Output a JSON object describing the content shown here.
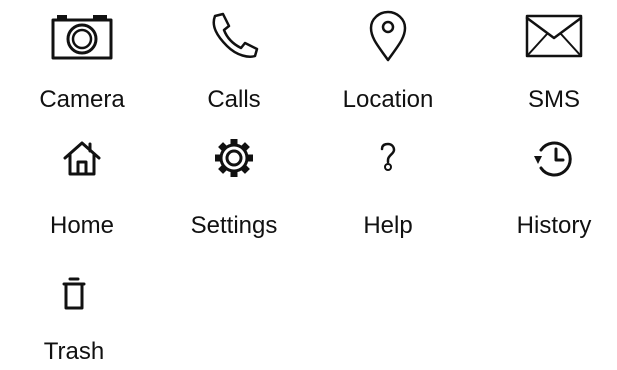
{
  "apps": [
    {
      "label": "Camera",
      "icon": "camera-icon"
    },
    {
      "label": "Calls",
      "icon": "phone-icon"
    },
    {
      "label": "Location",
      "icon": "map-pin-icon"
    },
    {
      "label": "SMS",
      "icon": "envelope-icon"
    },
    {
      "label": "Home",
      "icon": "home-icon"
    },
    {
      "label": "Settings",
      "icon": "gear-icon"
    },
    {
      "label": "Help",
      "icon": "question-icon"
    },
    {
      "label": "History",
      "icon": "history-icon"
    },
    {
      "label": "Trash",
      "icon": "trash-icon"
    }
  ],
  "colors": {
    "background": "#ffffff",
    "foreground": "#111111"
  }
}
